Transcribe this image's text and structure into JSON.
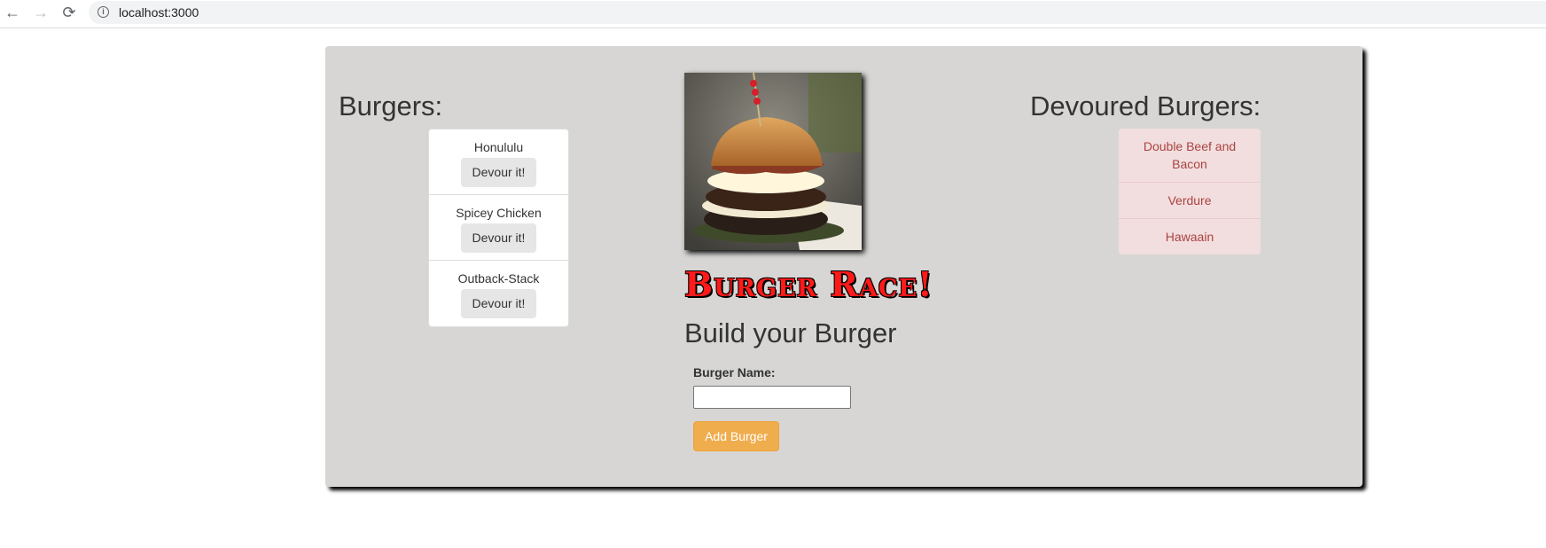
{
  "browser": {
    "back_icon": "←",
    "forward_icon": "→",
    "reload_icon": "⟳",
    "info_icon": "i",
    "url": "localhost:3000"
  },
  "left": {
    "title": "Burgers:",
    "burgers": [
      {
        "name": "Honululu",
        "button": "Devour it!"
      },
      {
        "name": "Spicey Chicken",
        "button": "Devour it!"
      },
      {
        "name": "Outback-Stack",
        "button": "Devour it!"
      }
    ]
  },
  "center": {
    "race_title": "Burger Race!",
    "build_title": "Build your Burger",
    "field_label": "Burger Name:",
    "field_value": "",
    "add_button": "Add Burger"
  },
  "right": {
    "title": "Devoured Burgers:",
    "burgers": [
      "Double Beef and Bacon",
      "Verdure",
      "Hawaain"
    ]
  },
  "colors": {
    "panel_bg": "#d7d6d5",
    "accent_orange": "#f0ad4e",
    "race_red": "#ff1a1a",
    "devoured_bg": "#f2dede",
    "devoured_text": "#a94442"
  }
}
